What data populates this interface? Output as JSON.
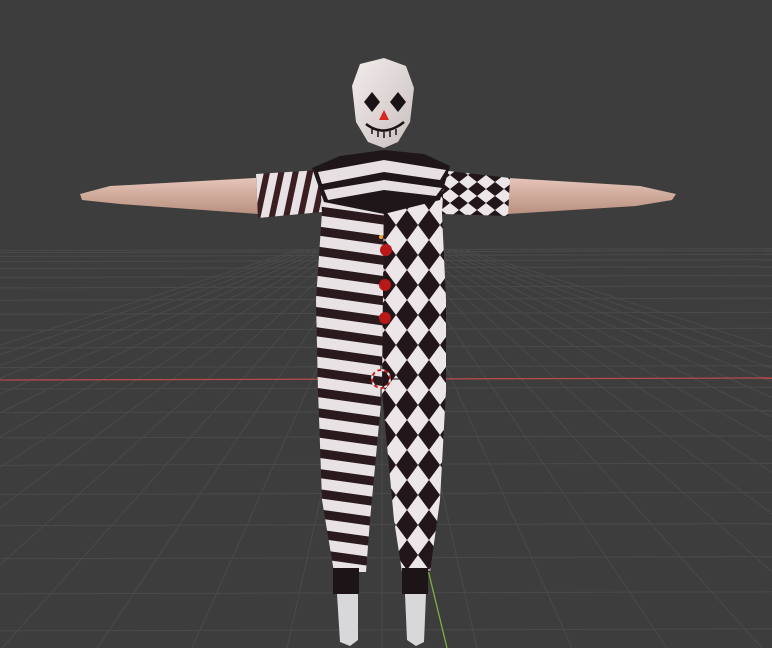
{
  "viewport": {
    "background_color": "#3d3d3d",
    "grid_color": "#4a4a4a",
    "x_axis_color": "#b84a4a",
    "y_axis_color": "#7fae3a",
    "cursor_icon": "3d-cursor-icon",
    "origin_icon": "object-origin-icon"
  },
  "model": {
    "costume_colors": {
      "dark": "#2a1a1e",
      "light": "#e8e2e4",
      "skin": "#dcb8ad",
      "buttons": "#b81818",
      "nose": "#d42a1e"
    }
  }
}
